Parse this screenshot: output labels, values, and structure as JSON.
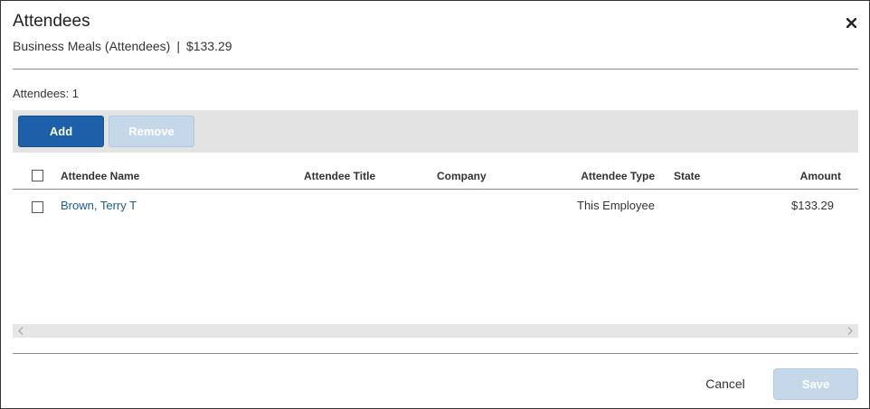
{
  "dialog": {
    "title": "Attendees",
    "subtitle": {
      "expense_type": "Business Meals (Attendees)",
      "separator": "|",
      "amount": "$133.29"
    },
    "close_icon": "close-icon"
  },
  "attendee_count": "Attendees: 1",
  "toolbar": {
    "add_label": "Add",
    "remove_label": "Remove"
  },
  "table": {
    "columns": {
      "name": "Attendee Name",
      "title": "Attendee Title",
      "company": "Company",
      "type": "Attendee Type",
      "state": "State",
      "amount": "Amount"
    },
    "rows": [
      {
        "name": "Brown, Terry T",
        "title": "",
        "company": "",
        "type": "This Employee",
        "state": "",
        "amount": "$133.29"
      }
    ]
  },
  "scrollbar": {
    "left_icon": "chevron-left-icon",
    "right_icon": "chevron-right-icon"
  },
  "footer": {
    "cancel_label": "Cancel",
    "save_label": "Save"
  },
  "colors": {
    "primary_button": "#1d5fa8",
    "disabled_button": "#c5d8ea",
    "link": "#1a5a96",
    "toolbar_bg": "#e3e3e3"
  }
}
